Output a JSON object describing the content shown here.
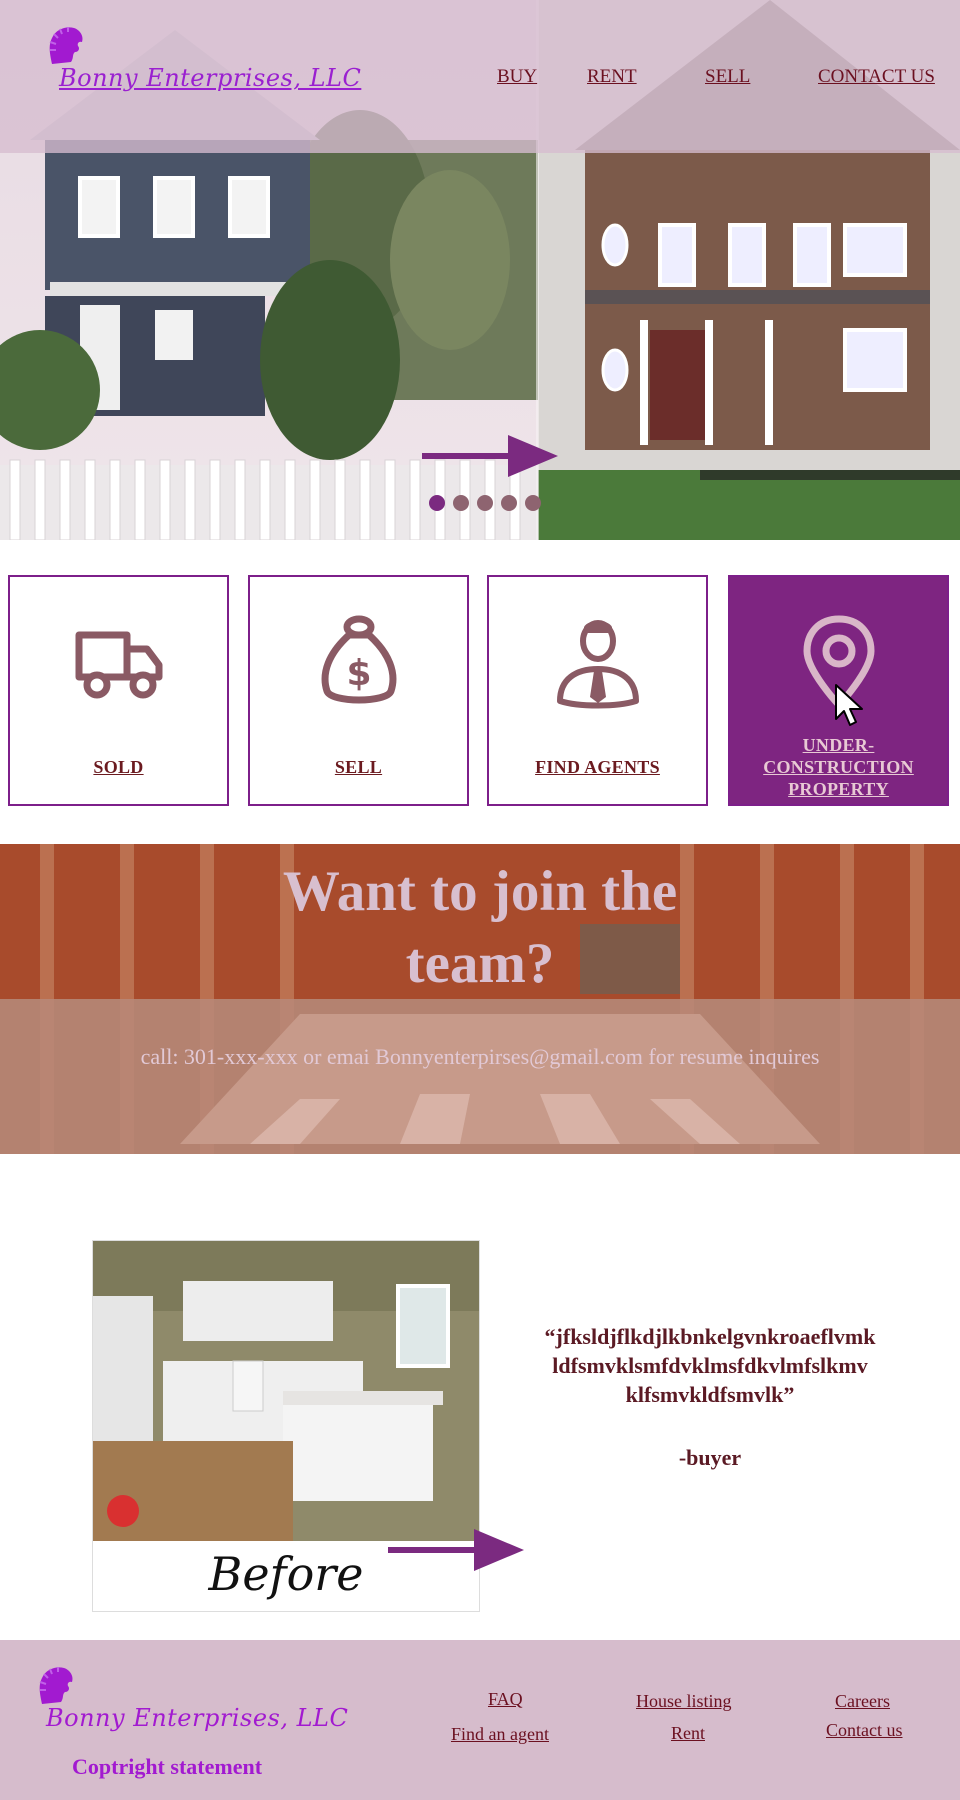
{
  "brand": {
    "name": "Bonny Enterprises, LLC"
  },
  "nav": {
    "buy": "BUY",
    "rent": "RENT",
    "sell": "SELL",
    "contact": "CONTACT US"
  },
  "carousel": {
    "slides": 5,
    "active_slide": 1
  },
  "cards": [
    {
      "label": "SOLD",
      "icon": "truck-icon"
    },
    {
      "label": "SELL",
      "icon": "money-bag-icon"
    },
    {
      "label": "FIND AGENTS",
      "icon": "agent-icon"
    },
    {
      "label_lines": [
        "UNDER-",
        "CONSTRUCTION",
        "PROPERTY"
      ],
      "icon": "map-pin-icon"
    }
  ],
  "join": {
    "title_line1": "Want to join the",
    "title_line2": "team?",
    "subtitle": "call: 301-xxx-xxx or emai Bonnyenterpirses@gmail.com for resume inquires"
  },
  "testimonial": {
    "before_label": "Before",
    "quote_line1": "“jfksldjflkdjlkbnkelgvnkroaeflvmk",
    "quote_line2": "ldfsmvklsmfdvklmsfdkvlmfslkmv",
    "quote_line3": "klfsmvkldfsmvlk”",
    "author": "-buyer"
  },
  "footer": {
    "brand_name": "Bonny Enterprises, LLC",
    "copyright": "Coptright statement",
    "links": {
      "faq": "FAQ",
      "find_agent": "Find an agent",
      "house_listing": "House listing",
      "rent": "Rent",
      "careers": "Careers",
      "contact_us": "Contact us"
    }
  },
  "colors": {
    "accent": "#7e2581",
    "brand_purple": "#a21ad0",
    "link": "#6b1020",
    "header_tint": "#d6bccf"
  }
}
